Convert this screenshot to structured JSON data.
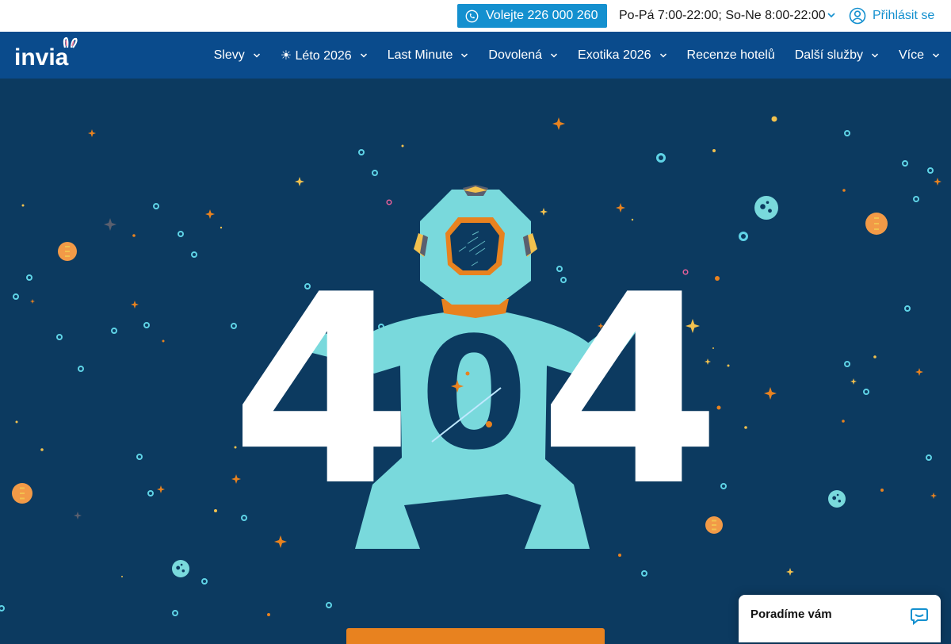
{
  "topbar": {
    "call_label": "Volejte 226 000 260",
    "hours": "Po-Pá 7:00-22:00; So-Ne 8:00-22:00",
    "login_label": "Přihlásit se"
  },
  "brand": {
    "logo_text": "invia"
  },
  "nav": {
    "items": [
      {
        "label": "Slevy",
        "dropdown": true
      },
      {
        "label": "☀ Léto 2026",
        "dropdown": true
      },
      {
        "label": "Last Minute",
        "dropdown": true
      },
      {
        "label": "Dovolená",
        "dropdown": true
      },
      {
        "label": "Exotika 2026",
        "dropdown": true
      },
      {
        "label": "Recenze hotelů",
        "dropdown": false
      },
      {
        "label": "Další služby",
        "dropdown": true
      },
      {
        "label": "Více",
        "dropdown": true
      }
    ]
  },
  "error": {
    "code_left": "4",
    "code_middle": "0",
    "code_right": "4"
  },
  "chat": {
    "label": "Poradíme vám"
  },
  "colors": {
    "topbar_bg": "#ffffff",
    "nav_bg": "#0a4b8c",
    "scene_bg": "#0c3a60",
    "accent_blue": "#1490cf",
    "astronaut": "#79d9dc",
    "orange": "#e8821f",
    "gold": "#f2c14e"
  }
}
